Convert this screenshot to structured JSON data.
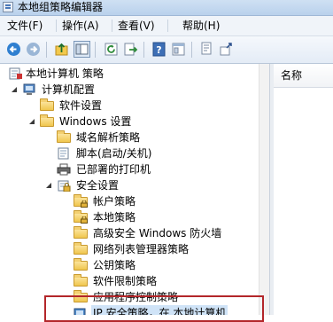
{
  "window": {
    "title": "本地组策略编辑器"
  },
  "menu": [
    {
      "label": "文件(F)"
    },
    {
      "label": "操作(A)"
    },
    {
      "label": "查看(V)"
    },
    {
      "label": "帮助(H)"
    }
  ],
  "toolbar_icons": [
    "back-icon",
    "forward-icon",
    "up-icon",
    "show-hide-tree-icon",
    "refresh-icon",
    "export-icon",
    "help-icon",
    "properties-icon",
    "filter-icon"
  ],
  "right_pane": {
    "column_name": "名称"
  },
  "tree": [
    {
      "label": "本地计算机 策略",
      "icon": "policy-icon",
      "state": "expanded"
    },
    {
      "label": "计算机配置",
      "icon": "computer-icon",
      "state": "expanded"
    },
    {
      "label": "软件设置",
      "icon": "folder-icon",
      "state": "collapsed"
    },
    {
      "label": "Windows 设置",
      "icon": "folder-icon",
      "state": "expanded"
    },
    {
      "label": "域名解析策略",
      "icon": "folder-icon",
      "state": "collapsed"
    },
    {
      "label": "脚本(启动/关机)",
      "icon": "script-icon",
      "state": "leaf"
    },
    {
      "label": "已部署的打印机",
      "icon": "printer-icon",
      "state": "collapsed"
    },
    {
      "label": "安全设置",
      "icon": "security-icon",
      "state": "expanded"
    },
    {
      "label": "帐户策略",
      "icon": "locked-folder-icon",
      "state": "collapsed"
    },
    {
      "label": "本地策略",
      "icon": "locked-folder-icon",
      "state": "collapsed"
    },
    {
      "label": "高级安全 Windows 防火墙",
      "icon": "folder-icon",
      "state": "collapsed"
    },
    {
      "label": "网络列表管理器策略",
      "icon": "folder-icon",
      "state": "leaf"
    },
    {
      "label": "公钥策略",
      "icon": "folder-icon",
      "state": "collapsed"
    },
    {
      "label": "软件限制策略",
      "icon": "folder-icon",
      "state": "collapsed"
    },
    {
      "label": "应用程序控制策略",
      "icon": "folder-icon",
      "state": "collapsed"
    },
    {
      "label": "IP 安全策略，在 本地计算机",
      "icon": "network-policy-icon",
      "state": "leaf"
    }
  ],
  "highlight_color": "#b3262a"
}
